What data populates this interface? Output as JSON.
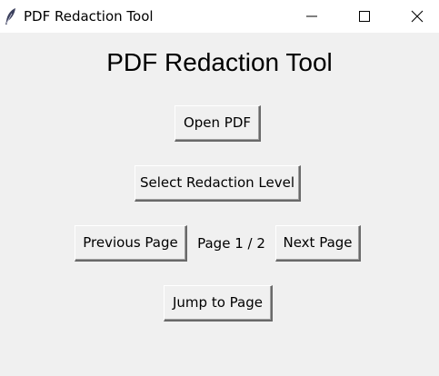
{
  "window": {
    "title": "PDF Redaction Tool",
    "app_icon": "feather-icon",
    "controls": [
      "minimize-icon",
      "maximize-icon",
      "close-icon"
    ]
  },
  "main": {
    "heading": "PDF Redaction Tool",
    "open_pdf_label": "Open PDF",
    "select_level_label": "Select Redaction Level",
    "prev_page_label": "Previous Page",
    "page_indicator": "Page 1 / 2",
    "next_page_label": "Next Page",
    "jump_label": "Jump to Page"
  },
  "colors": {
    "background": "#f0f0f0",
    "titlebar": "#ffffff",
    "text": "#000000"
  }
}
